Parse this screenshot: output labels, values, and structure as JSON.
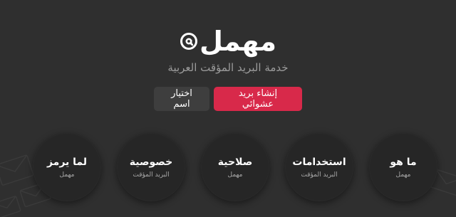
{
  "hero": {
    "logo_text": "مهمل",
    "tagline": "خدمة البريد المؤقت العربية"
  },
  "actions": {
    "choose_name": "اختيار اسم",
    "random": "إنشاء بريد عشوائي"
  },
  "circles": [
    {
      "title": "لما يرمز",
      "subtitle": "مهمل"
    },
    {
      "title": "خصوصية",
      "subtitle": "البريد المؤقت"
    },
    {
      "title": "صلاحية",
      "subtitle": "مهمل"
    },
    {
      "title": "استخدامات",
      "subtitle": "البريد المؤقت"
    },
    {
      "title": "ما هو",
      "subtitle": "مهمل"
    }
  ],
  "colors": {
    "background": "#2f2f2f",
    "accent": "#d8294a",
    "secondary_button": "#3e3e3e",
    "circle": "#262626"
  },
  "icons": {
    "logo": "at-sign-icon",
    "background": "envelope-icon"
  }
}
